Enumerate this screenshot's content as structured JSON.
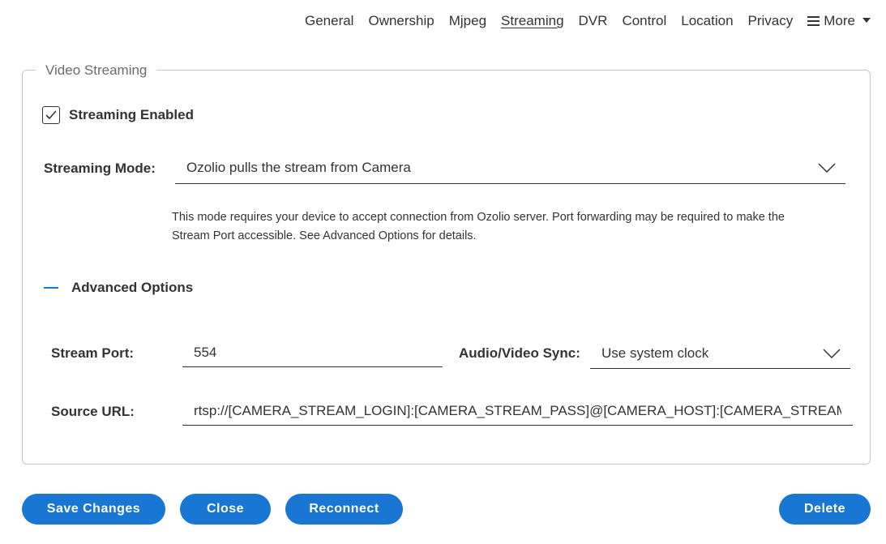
{
  "nav": {
    "items": [
      {
        "label": "General",
        "active": false
      },
      {
        "label": "Ownership",
        "active": false
      },
      {
        "label": "Mjpeg",
        "active": false
      },
      {
        "label": "Streaming",
        "active": true
      },
      {
        "label": "DVR",
        "active": false
      },
      {
        "label": "Control",
        "active": false
      },
      {
        "label": "Location",
        "active": false
      },
      {
        "label": "Privacy",
        "active": false
      }
    ],
    "more_label": "More",
    "more_icon": "hamburger-icon"
  },
  "panel": {
    "legend": "Video Streaming",
    "streaming_enabled": {
      "label": "Streaming Enabled",
      "checked": true
    },
    "streaming_mode": {
      "label": "Streaming Mode:",
      "value": "Ozolio pulls the stream from Camera"
    },
    "hint": "This mode requires your device to accept connection from Ozolio server. Port forwarding may be required to make the Stream Port accessible. See Advanced Options for details.",
    "advanced": {
      "label": "Advanced Options",
      "expanded": true,
      "stream_port": {
        "label": "Stream Port:",
        "value": "554"
      },
      "av_sync": {
        "label": "Audio/Video Sync:",
        "value": "Use system clock"
      },
      "source_url": {
        "label": "Source URL:",
        "value": "rtsp://[CAMERA_STREAM_LOGIN]:[CAMERA_STREAM_PASS]@[CAMERA_HOST]:[CAMERA_STREAM_PORT]"
      }
    }
  },
  "buttons": {
    "save": "Save Changes",
    "close": "Close",
    "reconnect": "Reconnect",
    "delete": "Delete"
  },
  "colors": {
    "accent": "#1976d2",
    "text": "#333333",
    "legend": "#6b6b6b",
    "border": "#c8c8c8"
  }
}
